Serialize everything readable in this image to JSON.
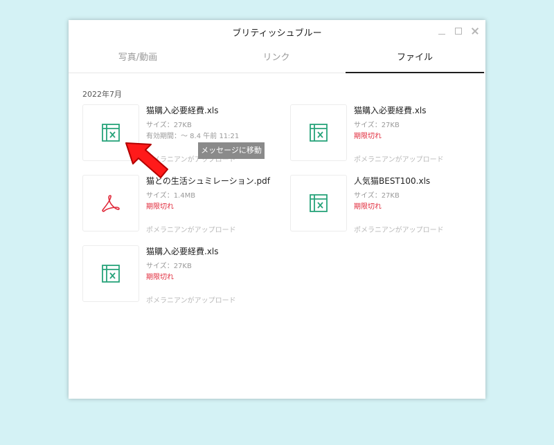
{
  "window": {
    "title": "ブリティッシュブルー",
    "controls": [
      "minimize-icon",
      "maximize-icon",
      "close-icon"
    ]
  },
  "tabs": [
    {
      "label": "写真/動画"
    },
    {
      "label": "リンク"
    },
    {
      "label": "ファイル",
      "active": true
    }
  ],
  "month_label": "2022年7月",
  "files": [
    {
      "name": "猫購入必要経費.xls",
      "size": "サイズ：27KB",
      "status": "有効期間：～ 8.4 午前 11:21",
      "expired": false,
      "uploader": "ポメラニアンがアップロード",
      "icon": "excel-file-icon"
    },
    {
      "name": "猫購入必要経費.xls",
      "size": "サイズ：27KB",
      "status": "期限切れ",
      "expired": true,
      "uploader": "ポメラニアンがアップロード",
      "icon": "excel-file-icon"
    },
    {
      "name": "猫との生活シュミレーション.pdf",
      "size": "サイズ：1.4MB",
      "status": "期限切れ",
      "expired": true,
      "uploader": "ポメラニアンがアップロード",
      "icon": "pdf-file-icon"
    },
    {
      "name": "人気猫BEST100.xls",
      "size": "サイズ：27KB",
      "status": "期限切れ",
      "expired": true,
      "uploader": "ポメラニアンがアップロード",
      "icon": "excel-file-icon"
    },
    {
      "name": "猫購入必要経費.xls",
      "size": "サイズ：27KB",
      "status": "期限切れ",
      "expired": true,
      "uploader": "ポメラニアンがアップロード",
      "icon": "excel-file-icon"
    }
  ],
  "tooltip": "メッセージに移動",
  "colors": {
    "background": "#d4f2f5",
    "excel_icon": "#27a37a",
    "pdf_icon": "#e0293a",
    "expired_text": "#e0293a",
    "active_tab_indicator": "#1e1e1e",
    "pointer_arrow": "#ff1a1a"
  }
}
